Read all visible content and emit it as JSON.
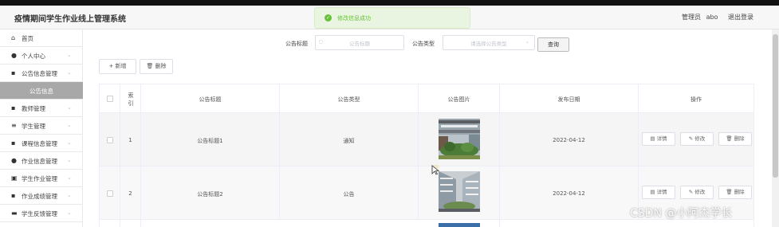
{
  "header": {
    "app_title": "疫情期间学生作业线上管理系统",
    "toast_message": "修改信息成功",
    "user_role": "管理员",
    "user_name": "abo",
    "logout_label": "退出登录"
  },
  "sidebar": {
    "items": [
      {
        "label": "首页",
        "icon": "home-icon"
      },
      {
        "label": "个人中心",
        "icon": "user-icon"
      },
      {
        "label": "公告信息管理",
        "icon": "grid-icon"
      },
      {
        "label": "公告信息",
        "icon": "none",
        "active": true
      },
      {
        "label": "教师管理",
        "icon": "grid-icon"
      },
      {
        "label": "学生管理",
        "icon": "list-icon"
      },
      {
        "label": "课程信息管理",
        "icon": "grid-icon"
      },
      {
        "label": "作业信息管理",
        "icon": "pin-icon"
      },
      {
        "label": "学生作业管理",
        "icon": "book-icon"
      },
      {
        "label": "作业成绩管理",
        "icon": "grid-icon"
      },
      {
        "label": "学生反馈管理",
        "icon": "doc-icon"
      }
    ]
  },
  "search": {
    "title_label": "公告标题",
    "title_placeholder": "公告标题",
    "type_label": "公告类型",
    "type_placeholder": "请选择公告类型",
    "query_label": "查询"
  },
  "toolbar": {
    "add_label": "+ 新增",
    "delete_label": "删除"
  },
  "table": {
    "headers": [
      "索引",
      "公告标题",
      "公告类型",
      "公告图片",
      "发布日期",
      "操作"
    ],
    "rows": [
      {
        "index": "1",
        "title": "公告标题1",
        "type": "通知",
        "date": "2022-04-12"
      },
      {
        "index": "2",
        "title": "公告标题2",
        "type": "公告",
        "date": "2022-04-12"
      }
    ],
    "actions": {
      "detail": "详情",
      "edit": "修改",
      "delete": "删除"
    }
  },
  "watermark": "CSDN @小阿杰学长",
  "colors": {
    "success": "#67c23a",
    "active_menu": "#a8a8a8",
    "topline": "#121212"
  }
}
